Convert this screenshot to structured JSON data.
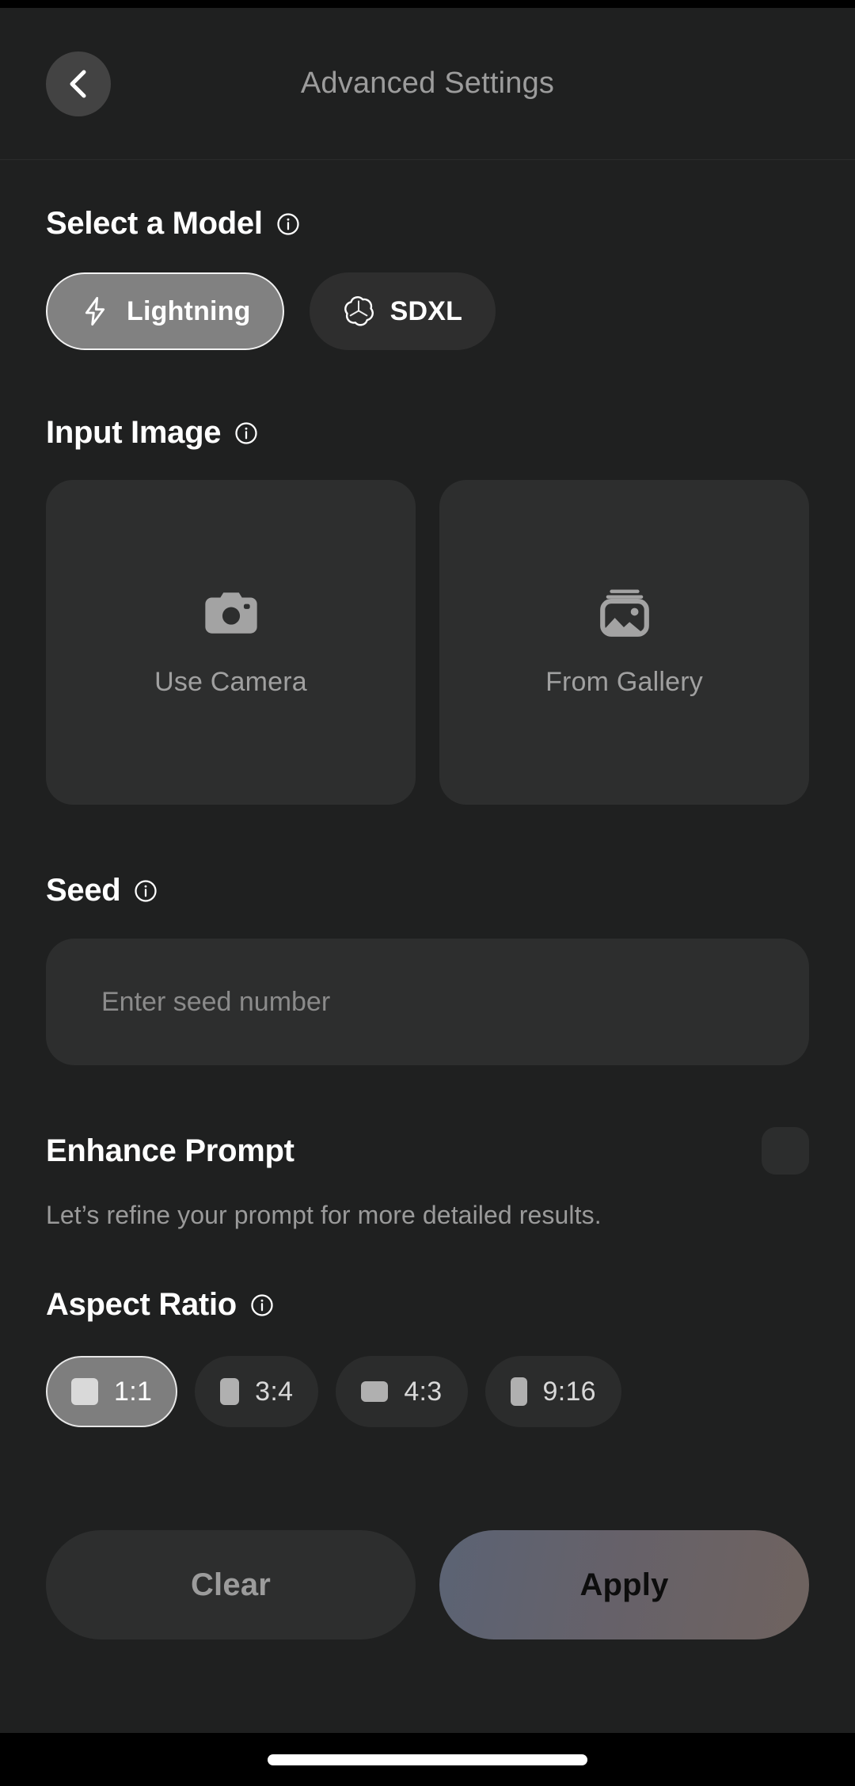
{
  "header": {
    "title": "Advanced Settings",
    "back_icon": "chevron-left-icon"
  },
  "model_section": {
    "title": "Select a Model",
    "info_icon": "info-icon",
    "options": [
      {
        "label": "Lightning",
        "icon": "lightning-bolt-icon",
        "selected": true
      },
      {
        "label": "SDXL",
        "icon": "openai-flower-icon",
        "selected": false
      }
    ]
  },
  "input_image_section": {
    "title": "Input Image",
    "info_icon": "info-icon",
    "cards": [
      {
        "label": "Use Camera",
        "icon": "camera-icon"
      },
      {
        "label": "From Gallery",
        "icon": "gallery-image-icon"
      }
    ]
  },
  "seed_section": {
    "title": "Seed",
    "info_icon": "info-icon",
    "placeholder": "Enter seed number",
    "value": ""
  },
  "enhance_section": {
    "title": "Enhance Prompt",
    "description": "Let’s refine your prompt for more detailed results.",
    "toggle_on": false
  },
  "aspect_ratio_section": {
    "title": "Aspect Ratio",
    "info_icon": "info-icon",
    "options": [
      {
        "label": "1:1",
        "selected": true
      },
      {
        "label": "3:4",
        "selected": false
      },
      {
        "label": "4:3",
        "selected": false
      },
      {
        "label": "9:16",
        "selected": false
      }
    ]
  },
  "footer": {
    "clear_label": "Clear",
    "apply_label": "Apply"
  },
  "colors": {
    "page_background": "#1f2020",
    "card_background": "#2d2e2e",
    "selected_pill": "#818181",
    "apply_gradient_start": "#5b6374",
    "apply_gradient_end": "#6f635f",
    "title_text": "#ffffff",
    "muted_text": "#9c9c9c"
  }
}
